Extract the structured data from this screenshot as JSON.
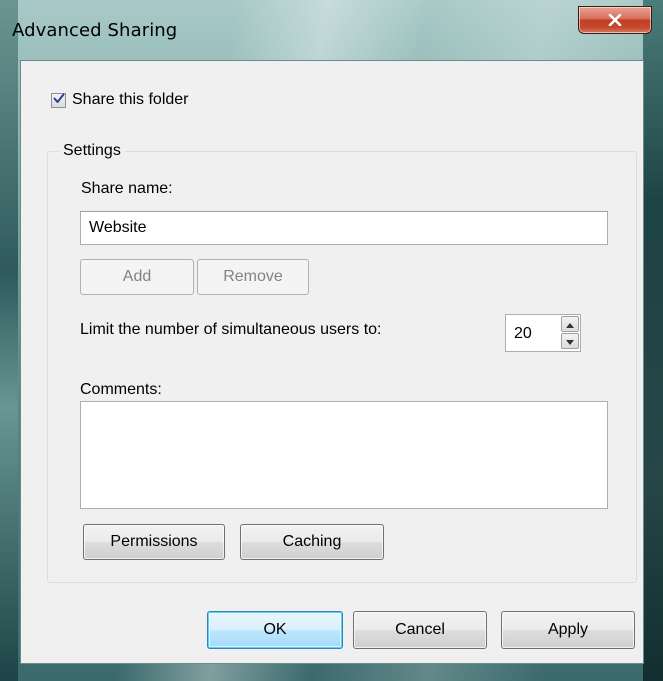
{
  "window": {
    "title": "Advanced Sharing",
    "close_icon": "close-icon"
  },
  "share_folder": {
    "label": "Share this folder",
    "checked": true
  },
  "settings": {
    "legend": "Settings",
    "share_name_label": "Share name:",
    "share_name_value": "Website",
    "add_label": "Add",
    "remove_label": "Remove",
    "limit_label": "Limit the number of simultaneous users to:",
    "limit_value": "20",
    "comments_label": "Comments:",
    "comments_value": "",
    "permissions_label": "Permissions",
    "caching_label": "Caching"
  },
  "buttons": {
    "ok_label": "OK",
    "cancel_label": "Cancel",
    "apply_label": "Apply"
  },
  "colors": {
    "dialog_bg": "#f0f0f0",
    "close_button_red": "#c13f22",
    "default_button_blue": "#3c7fb1"
  }
}
